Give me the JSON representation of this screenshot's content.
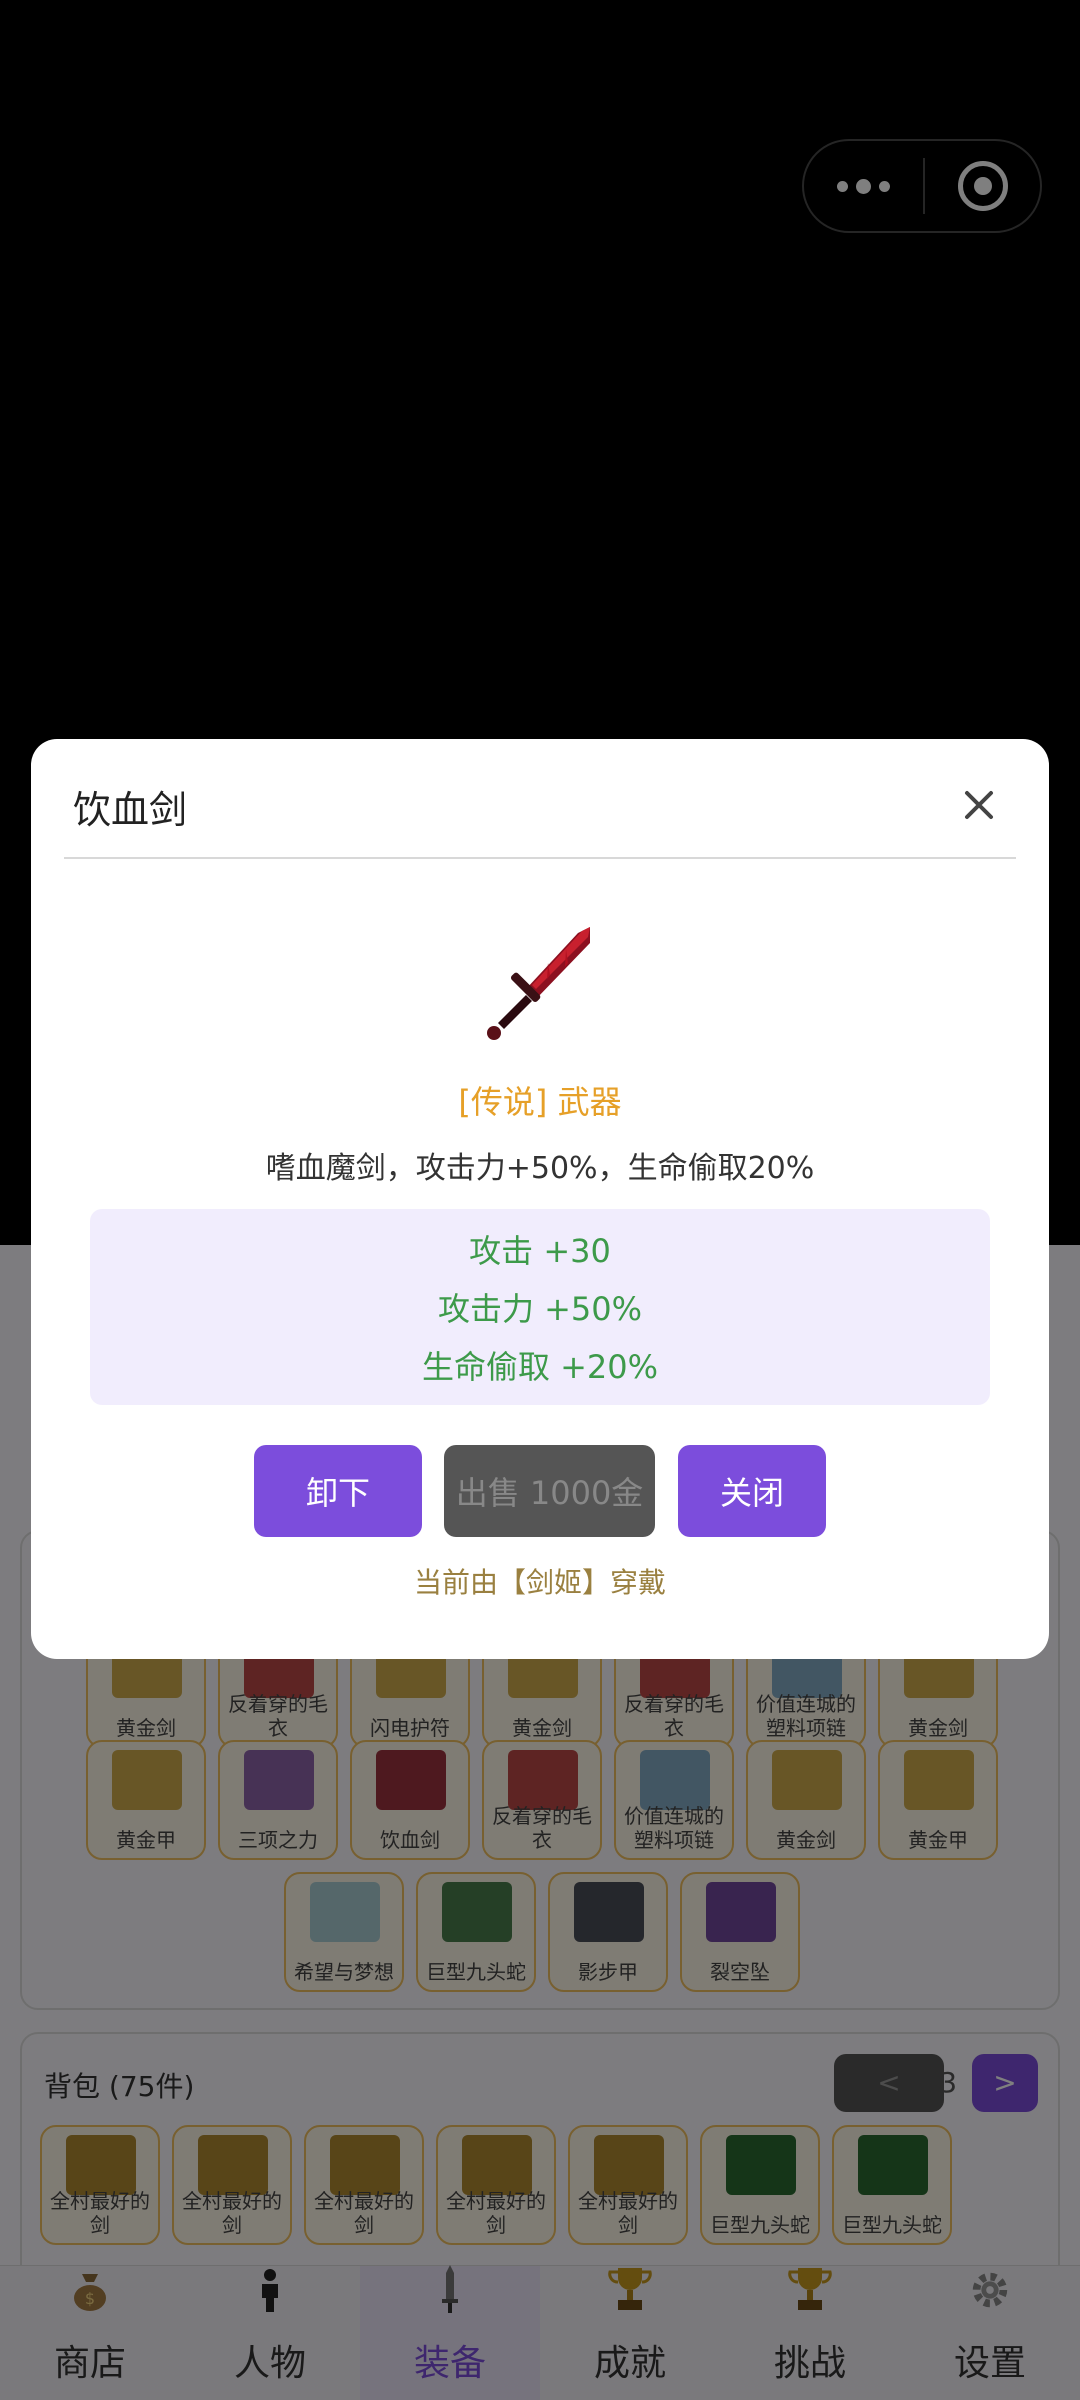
{
  "capsule": {
    "more_icon": "more-dots-icon",
    "close_icon": "target-circle-icon"
  },
  "equipped_items": [
    {
      "name": "黄金剑"
    },
    {
      "name": "反着穿的毛衣"
    },
    {
      "name": "闪电护符"
    },
    {
      "name": "黄金剑"
    },
    {
      "name": "反着穿的毛衣"
    },
    {
      "name": "价值连城的塑料项链"
    },
    {
      "name": "黄金剑"
    },
    {
      "name": "黄金甲"
    },
    {
      "name": "三项之力"
    },
    {
      "name": "饮血剑"
    },
    {
      "name": "反着穿的毛衣"
    },
    {
      "name": "价值连城的塑料项链"
    },
    {
      "name": "黄金剑"
    },
    {
      "name": "黄金甲"
    },
    {
      "name": "希望与梦想"
    },
    {
      "name": "巨型九头蛇"
    },
    {
      "name": "影步甲"
    },
    {
      "name": "裂空坠"
    }
  ],
  "bag": {
    "title": "背包 (75件)",
    "page": "1/3",
    "prev": "<",
    "next": ">",
    "items": [
      {
        "name": "全村最好的剑"
      },
      {
        "name": "全村最好的剑"
      },
      {
        "name": "全村最好的剑"
      },
      {
        "name": "全村最好的剑"
      },
      {
        "name": "全村最好的剑"
      },
      {
        "name": "巨型九头蛇"
      },
      {
        "name": "巨型九头蛇"
      }
    ],
    "worn_tag": "剑姬"
  },
  "tabs": [
    {
      "label": "商店",
      "icon": "money-bag-icon"
    },
    {
      "label": "人物",
      "icon": "person-icon"
    },
    {
      "label": "装备",
      "icon": "sword-icon",
      "active": true
    },
    {
      "label": "成就",
      "icon": "trophy-icon"
    },
    {
      "label": "挑战",
      "icon": "trophy-icon"
    },
    {
      "label": "设置",
      "icon": "gear-icon"
    }
  ],
  "modal": {
    "title": "饮血剑",
    "close_icon": "close-x-icon",
    "item_icon": "bloody-sword-icon",
    "rarity": "[传说] 武器",
    "description": "嗜血魔剑，攻击力+50%，生命偷取20%",
    "stats": [
      "攻击 +30",
      "攻击力 +50%",
      "生命偷取 +20%"
    ],
    "buttons": {
      "unequip": "卸下",
      "sell": "出售 1000金",
      "close": "关闭"
    },
    "worn_by": "当前由【剑姬】穿戴",
    "colors": {
      "accent": "#7c4ddc",
      "rarity": "#e6a028",
      "stat": "#3d9a4a"
    }
  }
}
